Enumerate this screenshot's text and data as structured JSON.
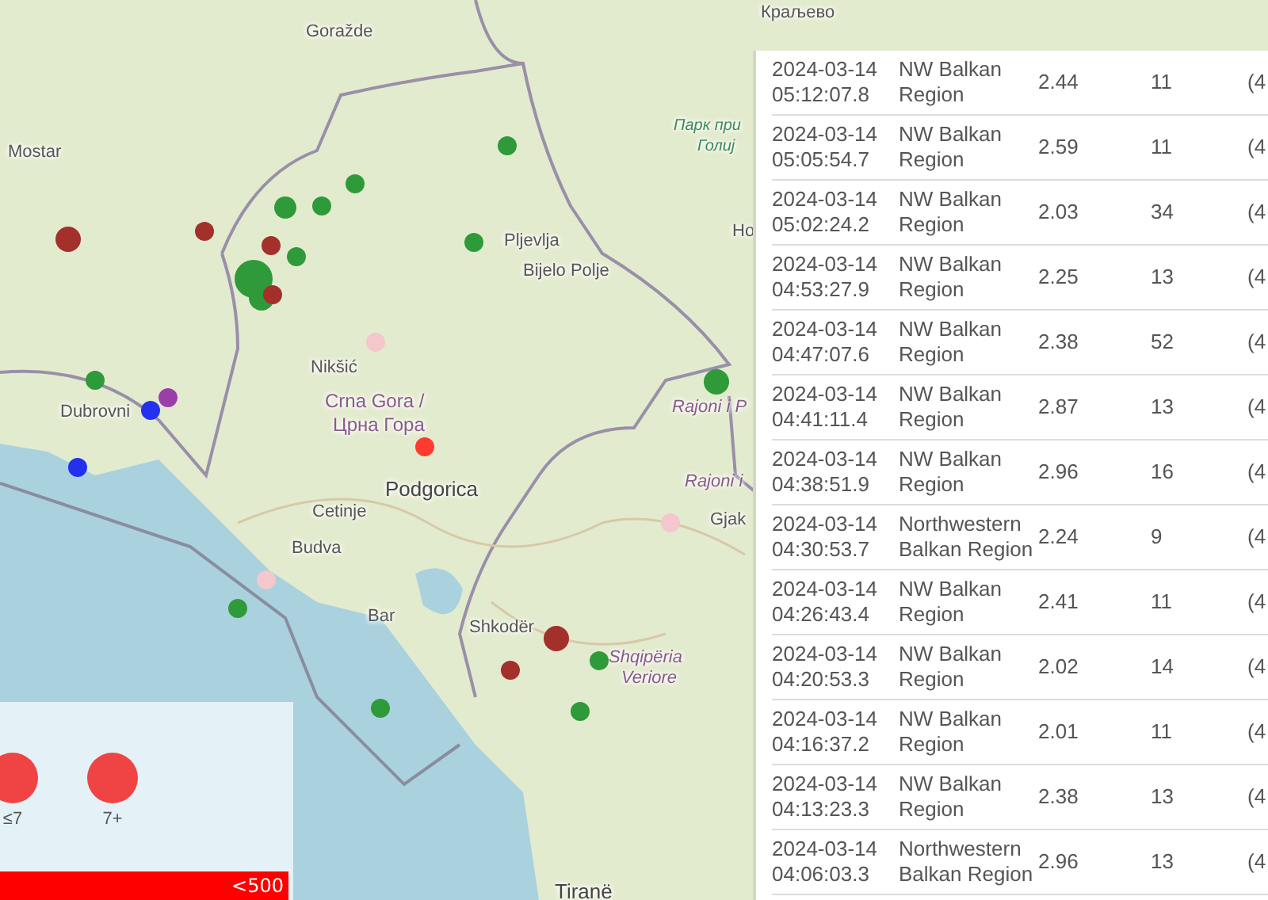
{
  "map": {
    "labels": [
      {
        "text": "Goražde",
        "kind": "town"
      },
      {
        "text": "Mostar",
        "kind": "town"
      },
      {
        "text": "Pljevlja",
        "kind": "town"
      },
      {
        "text": "Bijelo Polje",
        "kind": "town"
      },
      {
        "text": "Nikšić",
        "kind": "town"
      },
      {
        "text": "Crna Gora /",
        "kind": "country"
      },
      {
        "text": "Црна Гора",
        "kind": "country"
      },
      {
        "text": "Podgorica",
        "kind": "capital"
      },
      {
        "text": "Cetinje",
        "kind": "town"
      },
      {
        "text": "Budva",
        "kind": "town"
      },
      {
        "text": "Bar",
        "kind": "town"
      },
      {
        "text": "Shkodër",
        "kind": "town"
      },
      {
        "text": "Shqipëria",
        "kind": "region"
      },
      {
        "text": "Veriore",
        "kind": "region"
      },
      {
        "text": "Dubrovni",
        "kind": "town"
      },
      {
        "text": "Краљево",
        "kind": "town"
      },
      {
        "text": "Парк при",
        "kind": "park"
      },
      {
        "text": "Голиј",
        "kind": "park"
      },
      {
        "text": "Ho",
        "kind": "town"
      },
      {
        "text": "Rajoni i P",
        "kind": "region"
      },
      {
        "text": "Rajoni i",
        "kind": "region"
      },
      {
        "text": "Gjak",
        "kind": "town"
      },
      {
        "text": "Tiranë",
        "kind": "capital"
      }
    ],
    "markers": [
      {
        "color": "#2e9a3a"
      },
      {
        "color": "#2e9a3a"
      },
      {
        "color": "#2e9a3a"
      },
      {
        "color": "#2e9a3a"
      },
      {
        "color": "#2e9a3a"
      },
      {
        "color": "#2e9a3a"
      },
      {
        "color": "#2e9a3a"
      },
      {
        "color": "#2e9a3a"
      },
      {
        "color": "#2e9a3a"
      },
      {
        "color": "#2e9a3a"
      },
      {
        "color": "#2e9a3a"
      },
      {
        "color": "#2e9a3a"
      },
      {
        "color": "#2e9a3a"
      },
      {
        "color": "#2e9a3a"
      },
      {
        "color": "#a3302b"
      },
      {
        "color": "#a3302b"
      },
      {
        "color": "#a3302b"
      },
      {
        "color": "#a3302b"
      },
      {
        "color": "#a3302b"
      },
      {
        "color": "#a3302b"
      },
      {
        "color": "#f4c7cc"
      },
      {
        "color": "#f4c7cc"
      },
      {
        "color": "#f4c7cc"
      },
      {
        "color": "#ff3b30"
      },
      {
        "color": "#9b3fa8"
      },
      {
        "color": "#2430f0"
      },
      {
        "color": "#2430f0"
      }
    ]
  },
  "legend": {
    "items": [
      {
        "label": "≤7"
      },
      {
        "label": "7+"
      }
    ],
    "bar_label": "<500"
  },
  "table": {
    "rows": [
      {
        "date": "2024-03-14",
        "time": "05:12:07.8",
        "region": "NW Balkan Region",
        "magnitude": "2.44",
        "depth": "11",
        "column_5": "(4"
      },
      {
        "date": "2024-03-14",
        "time": "05:05:54.7",
        "region": "NW Balkan Region",
        "magnitude": "2.59",
        "depth": "11",
        "column_5": "(4"
      },
      {
        "date": "2024-03-14",
        "time": "05:02:24.2",
        "region": "NW Balkan Region",
        "magnitude": "2.03",
        "depth": "34",
        "column_5": "(4"
      },
      {
        "date": "2024-03-14",
        "time": "04:53:27.9",
        "region": "NW Balkan Region",
        "magnitude": "2.25",
        "depth": "13",
        "column_5": "(4"
      },
      {
        "date": "2024-03-14",
        "time": "04:47:07.6",
        "region": "NW Balkan Region",
        "magnitude": "2.38",
        "depth": "52",
        "column_5": "(4"
      },
      {
        "date": "2024-03-14",
        "time": "04:41:11.4",
        "region": "NW Balkan Region",
        "magnitude": "2.87",
        "depth": "13",
        "column_5": "(4"
      },
      {
        "date": "2024-03-14",
        "time": "04:38:51.9",
        "region": "NW Balkan Region",
        "magnitude": "2.96",
        "depth": "16",
        "column_5": "(4"
      },
      {
        "date": "2024-03-14",
        "time": "04:30:53.7",
        "region": "Northwestern Balkan Region",
        "magnitude": "2.24",
        "depth": "9",
        "column_5": "(4"
      },
      {
        "date": "2024-03-14",
        "time": "04:26:43.4",
        "region": "NW Balkan Region",
        "magnitude": "2.41",
        "depth": "11",
        "column_5": "(4"
      },
      {
        "date": "2024-03-14",
        "time": "04:20:53.3",
        "region": "NW Balkan Region",
        "magnitude": "2.02",
        "depth": "14",
        "column_5": "(4"
      },
      {
        "date": "2024-03-14",
        "time": "04:16:37.2",
        "region": "NW Balkan Region",
        "magnitude": "2.01",
        "depth": "11",
        "column_5": "(4"
      },
      {
        "date": "2024-03-14",
        "time": "04:13:23.3",
        "region": "NW Balkan Region",
        "magnitude": "2.38",
        "depth": "13",
        "column_5": "(4"
      },
      {
        "date": "2024-03-14",
        "time": "04:06:03.3",
        "region": "Northwestern Balkan Region",
        "magnitude": "2.96",
        "depth": "13",
        "column_5": "(4"
      }
    ]
  }
}
